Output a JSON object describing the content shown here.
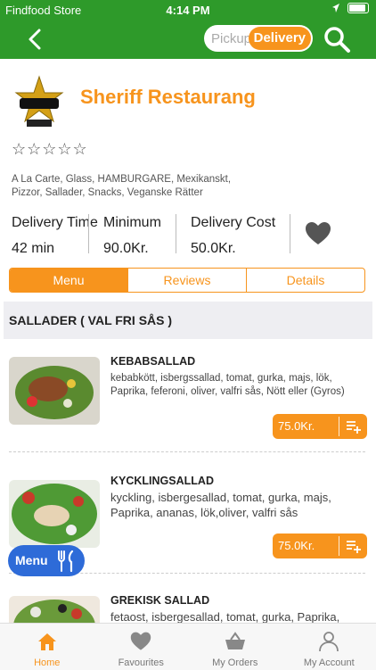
{
  "status_bar": {
    "carrier": "Findfood Store",
    "time": "4:14 PM"
  },
  "header": {
    "pickup_label": "Pickup",
    "delivery_label": "Delivery",
    "mode": "Delivery"
  },
  "restaurant": {
    "name": "Sheriff Restaurang",
    "rating_stars": "☆☆☆☆☆",
    "rating": 0,
    "categories": "A La Carte, Glass, HAMBURGARE, Mexikanskt, Pizzor, Sallader, Snacks, Veganske Rätter"
  },
  "info": {
    "delivery_time_label": "Delivery Time",
    "delivery_time_value": "42 min",
    "minimum_label": "Minimum",
    "minimum_value": "90.0Kr.",
    "delivery_cost_label": "Delivery Cost",
    "delivery_cost_value": "50.0Kr."
  },
  "tabs": [
    {
      "label": "Menu",
      "active": true
    },
    {
      "label": "Reviews",
      "active": false
    },
    {
      "label": "Details",
      "active": false
    }
  ],
  "section_title": "SALLADER ( VAL FRI SÅS )",
  "items": [
    {
      "title": "KEBABSALLAD",
      "desc": "kebabkött, isbergssallad, tomat, gurka, majs, lök, Paprika,  feferoni, oliver, valfri sås, Nött eller (Gyros)",
      "price": "75.0Kr."
    },
    {
      "title": "KYCKLINGSALLAD",
      "desc": "kyckling, isbergesallad, tomat, gurka, majs, Paprika, ananas, lök,oliver, valfri sås",
      "price": "75.0Kr."
    },
    {
      "title": "GREKISK SALLAD",
      "desc": "fetaost, isbergesallad, tomat, gurka, Paprika,"
    }
  ],
  "menu_fab_label": "Menu",
  "tab_bar": [
    {
      "label": "Home",
      "icon": "home-icon",
      "active": true
    },
    {
      "label": "Favourites",
      "icon": "heart-icon",
      "active": false
    },
    {
      "label": "My Orders",
      "icon": "basket-icon",
      "active": false
    },
    {
      "label": "My Account",
      "icon": "user-icon",
      "active": false
    }
  ],
  "colors": {
    "green": "#2e9a2a",
    "orange": "#f7941d",
    "fab_blue": "#2e6bd8"
  }
}
